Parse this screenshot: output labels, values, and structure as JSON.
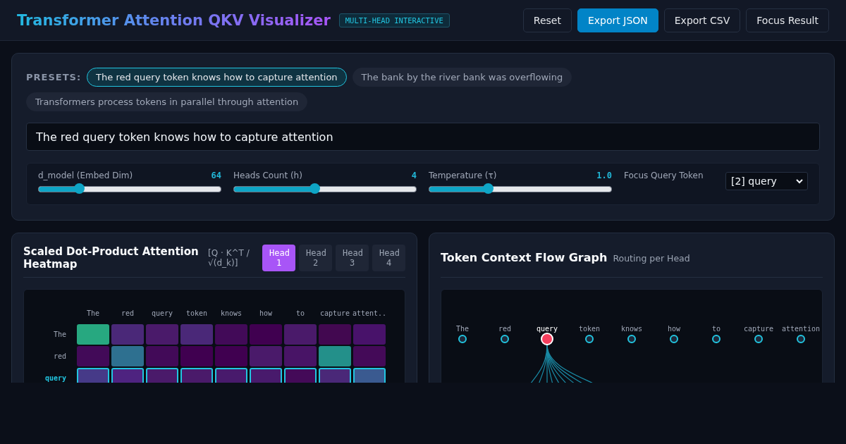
{
  "header": {
    "title": "Transformer Attention QKV Visualizer",
    "badge": "MULTI-HEAD INTERACTIVE",
    "buttons": [
      {
        "label": "Reset",
        "kind": "plain"
      },
      {
        "label": "Export JSON",
        "kind": "primary"
      },
      {
        "label": "Export CSV",
        "kind": "plain"
      },
      {
        "label": "Focus Result",
        "kind": "plain"
      }
    ]
  },
  "controls": {
    "presets_label": "PRESETS:",
    "presets": [
      {
        "label": "The red query token knows how to capture attention",
        "selected": true
      },
      {
        "label": "The bank by the river bank was overflowing",
        "selected": false
      },
      {
        "label": "Transformers process tokens in parallel through attention",
        "selected": false
      }
    ],
    "input": {
      "value": "The red query token knows how to capture attention"
    },
    "sliders": [
      {
        "label": "d_model (Embed Dim)",
        "reading": "64",
        "level": 0.22
      },
      {
        "label": "Heads Count (h)",
        "reading": "4",
        "level": 0.44
      },
      {
        "label": "Temperature (τ)",
        "reading": "1.0",
        "level": 0.32
      }
    ],
    "focus": {
      "label": "Focus Query Token",
      "value": "[2] query"
    }
  },
  "heatmap": {
    "title": "Scaled Dot-Product Attention Heatmap",
    "formula": "[Q · K^T / √(d_k)]",
    "tabs": [
      {
        "label": "Head 1",
        "selected": true
      },
      {
        "label": "Head 2",
        "selected": false
      },
      {
        "label": "Head 3",
        "selected": false
      },
      {
        "label": "Head 4",
        "selected": false
      }
    ],
    "columns": [
      "The",
      "red",
      "query",
      "token",
      "knows",
      "how",
      "to",
      "capture",
      "attent.."
    ],
    "rows": [
      {
        "label": "The",
        "selected": false,
        "cells": [
          {
            "color": "#27a880"
          },
          {
            "color": "#4a2878"
          },
          {
            "color": "#4a1a6a"
          },
          {
            "color": "#4a2878"
          },
          {
            "color": "#420a58"
          },
          {
            "color": "#400050"
          },
          {
            "color": "#4a1a6a"
          },
          {
            "color": "#420850"
          },
          {
            "color": "#48126a"
          }
        ]
      },
      {
        "label": "red",
        "selected": false,
        "cells": [
          {
            "color": "#420a58"
          },
          {
            "color": "#2e7090"
          },
          {
            "color": "#420a58"
          },
          {
            "color": "#400050"
          },
          {
            "color": "#400050"
          },
          {
            "color": "#4a1a6a"
          },
          {
            "color": "#481466"
          },
          {
            "color": "#23908a"
          },
          {
            "color": "#440a58"
          }
        ]
      },
      {
        "label": "query",
        "selected": true,
        "cells": [
          {
            "color": "#463a88"
          },
          {
            "color": "#4e2380"
          },
          {
            "color": "#4a1a6a"
          },
          {
            "color": "#4a1a6a"
          },
          {
            "color": "#481a6c"
          },
          {
            "color": "#481a6c"
          },
          {
            "color": "#440a58"
          },
          {
            "color": "#4a2878"
          },
          {
            "color": "#3a5a90"
          }
        ]
      }
    ]
  },
  "flow": {
    "title": "Token Context Flow Graph",
    "subtitle": "Routing per Head",
    "nodes": [
      {
        "label": "The",
        "selected": false
      },
      {
        "label": "red",
        "selected": false
      },
      {
        "label": "query",
        "selected": true
      },
      {
        "label": "token",
        "selected": false
      },
      {
        "label": "knows",
        "selected": false
      },
      {
        "label": "how",
        "selected": false
      },
      {
        "label": "to",
        "selected": false
      },
      {
        "label": "capture",
        "selected": false
      },
      {
        "label": "attention",
        "selected": false
      }
    ]
  }
}
